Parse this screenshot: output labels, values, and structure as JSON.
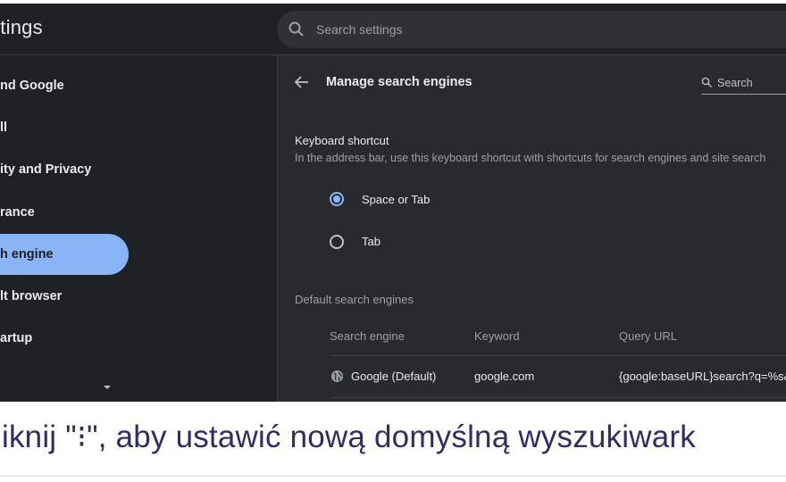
{
  "app": {
    "title": "ttings"
  },
  "search": {
    "placeholder": "Search settings"
  },
  "sidebar": {
    "items": [
      {
        "label": "nd Google"
      },
      {
        "label": "ll"
      },
      {
        "label": "ity and Privacy"
      },
      {
        "label": "rance"
      },
      {
        "label": "h engine",
        "active": true
      },
      {
        "label": "lt browser"
      },
      {
        "label": "artup"
      }
    ]
  },
  "main": {
    "title": "Manage search engines",
    "search_label": "Search",
    "keyboard": {
      "heading": "Keyboard shortcut",
      "description": "In the address bar, use this keyboard shortcut with shortcuts for search engines and site search",
      "options": [
        {
          "label": "Space or Tab",
          "selected": true
        },
        {
          "label": "Tab",
          "selected": false
        }
      ]
    },
    "default_engines": {
      "heading": "Default search engines",
      "columns": [
        "Search engine",
        "Keyword",
        "Query URL"
      ],
      "rows": [
        {
          "engine": "Google (Default)",
          "keyword": "google.com",
          "url": "{google:baseURL}search?q=%s&{"
        }
      ]
    }
  },
  "caption": {
    "text": "liknij \"⁝\", aby ustawić nową domyślną wyszukiwark"
  },
  "colors": {
    "accent": "#8ab4f8",
    "background": "#202124",
    "panel": "#292a2d",
    "caption_text": "#2f2c66"
  }
}
